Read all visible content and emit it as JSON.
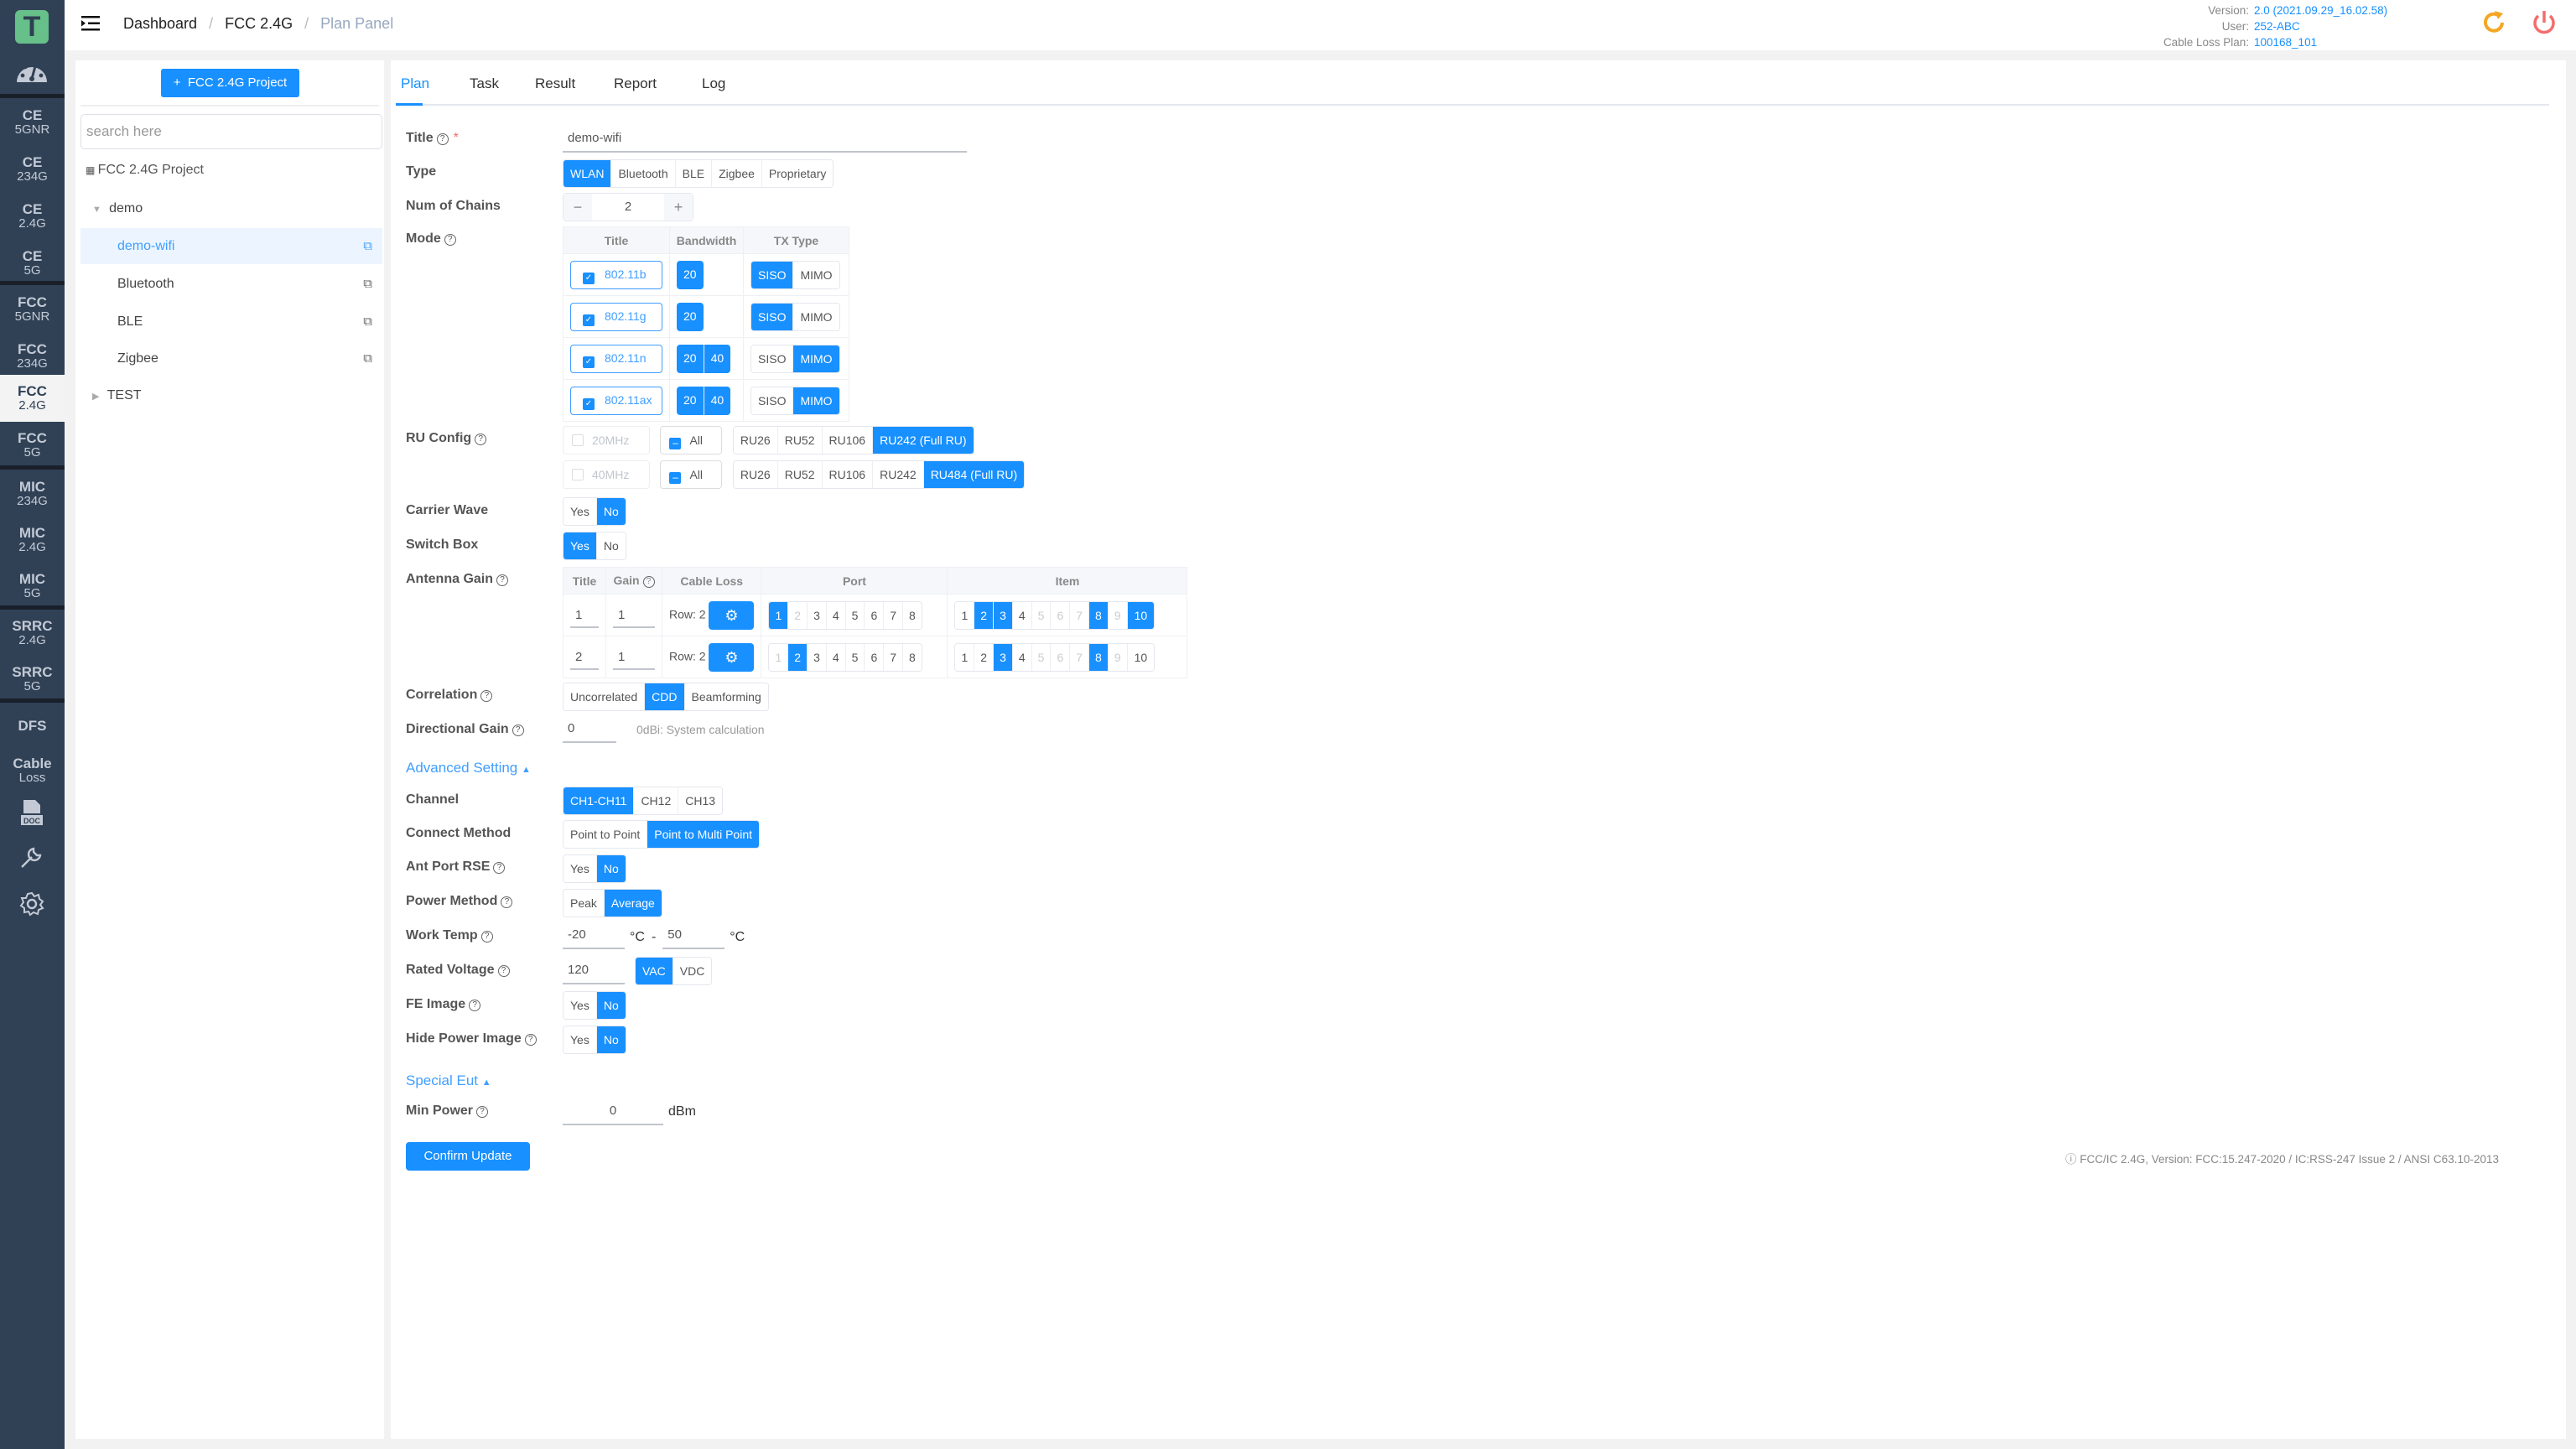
{
  "header": {
    "breadcrumb": [
      "Dashboard",
      "FCC 2.4G",
      "Plan Panel"
    ],
    "info": {
      "version_label": "Version:",
      "version": "2.0 (2021.09.29_16.02.58)",
      "user_label": "User:",
      "user": "252-ABC",
      "cable_label": "Cable Loss Plan:",
      "cable": "100168_101"
    },
    "colors": {
      "refresh": "#f5a623",
      "power": "#f56c6c",
      "accent": "#1890ff"
    }
  },
  "rail": {
    "logo": "T",
    "items": [
      {
        "top": "CE",
        "bottom": "5GNR"
      },
      {
        "top": "CE",
        "bottom": "234G"
      },
      {
        "top": "CE",
        "bottom": "2.4G"
      },
      {
        "top": "CE",
        "bottom": "5G"
      },
      {
        "top": "FCC",
        "bottom": "5GNR"
      },
      {
        "top": "FCC",
        "bottom": "234G"
      },
      {
        "top": "FCC",
        "bottom": "2.4G"
      },
      {
        "top": "FCC",
        "bottom": "5G"
      },
      {
        "top": "MIC",
        "bottom": "234G"
      },
      {
        "top": "MIC",
        "bottom": "2.4G"
      },
      {
        "top": "MIC",
        "bottom": "5G"
      },
      {
        "top": "SRRC",
        "bottom": "2.4G"
      },
      {
        "top": "SRRC",
        "bottom": "5G"
      },
      {
        "top": "DFS",
        "bottom": ""
      },
      {
        "top": "Cable",
        "bottom": "Loss"
      }
    ],
    "active": "FCC 2.4G"
  },
  "project": {
    "add_button": "FCC 2.4G Project",
    "search_placeholder": "search here",
    "root": "FCC 2.4G Project",
    "tree": [
      {
        "label": "demo",
        "expanded": true
      },
      {
        "label": "demo-wifi",
        "selected": true
      },
      {
        "label": "Bluetooth"
      },
      {
        "label": "BLE"
      },
      {
        "label": "Zigbee"
      },
      {
        "label": "TEST",
        "expanded": false
      }
    ]
  },
  "tabs": [
    "Plan",
    "Task",
    "Result",
    "Report",
    "Log"
  ],
  "form": {
    "title_label": "Title",
    "title_value": "demo-wifi",
    "type_label": "Type",
    "type_options": [
      "WLAN",
      "Bluetooth",
      "BLE",
      "Zigbee",
      "Proprietary"
    ],
    "type_selected": "WLAN",
    "chains_label": "Num of Chains",
    "chains_value": "2",
    "mode_label": "Mode",
    "mode_headers": [
      "Title",
      "Bandwidth",
      "TX Type"
    ],
    "modes": [
      {
        "title": "802.11b",
        "bw": [
          "20"
        ],
        "tx": "SISO"
      },
      {
        "title": "802.11g",
        "bw": [
          "20"
        ],
        "tx": "SISO"
      },
      {
        "title": "802.11n",
        "bw": [
          "20",
          "40"
        ],
        "tx": "MIMO"
      },
      {
        "title": "802.11ax",
        "bw": [
          "20",
          "40"
        ],
        "tx": "MIMO"
      }
    ],
    "tx_options": [
      "SISO",
      "MIMO"
    ],
    "ru_label": "RU Config",
    "ru": [
      {
        "bw": "20MHz",
        "all": "All",
        "options": [
          "RU26",
          "RU52",
          "RU106",
          "RU242 (Full RU)"
        ],
        "selected": "RU242 (Full RU)"
      },
      {
        "bw": "40MHz",
        "all": "All",
        "options": [
          "RU26",
          "RU52",
          "RU106",
          "RU242",
          "RU484 (Full RU)"
        ],
        "selected": "RU484 (Full RU)"
      }
    ],
    "carrier_label": "Carrier Wave",
    "carrier": "No",
    "switch_label": "Switch Box",
    "switch": "Yes",
    "yes": "Yes",
    "no": "No",
    "antenna_label": "Antenna Gain",
    "antenna_headers": [
      "Title",
      "Gain",
      "Cable Loss",
      "Port",
      "Item"
    ],
    "antennas": [
      {
        "title": "1",
        "gain": "1",
        "row": "Row: 2",
        "port_selected": [
          1
        ],
        "port_disabled": [
          2
        ],
        "item_selected": [
          2,
          3,
          8,
          10
        ],
        "item_disabled": [
          5,
          6,
          7,
          9
        ]
      },
      {
        "title": "2",
        "gain": "1",
        "row": "Row: 2",
        "port_selected": [
          2
        ],
        "port_disabled": [
          1
        ],
        "item_selected": [
          3,
          8
        ],
        "item_disabled": [
          5,
          6,
          7,
          9
        ]
      }
    ],
    "correlation_label": "Correlation",
    "correlation_options": [
      "Uncorrelated",
      "CDD",
      "Beamforming"
    ],
    "correlation": "CDD",
    "dgain_label": "Directional Gain",
    "dgain_value": "0",
    "dgain_hint": "0dBi: System calculation",
    "advanced_label": "Advanced Setting",
    "channel_label": "Channel",
    "channel_options": [
      "CH1-CH11",
      "CH12",
      "CH13"
    ],
    "channel": "CH1-CH11",
    "connect_label": "Connect Method",
    "connect_options": [
      "Point to Point",
      "Point to Multi Point"
    ],
    "connect": "Point to Multi Point",
    "rse_label": "Ant Port RSE",
    "rse": "No",
    "power_label": "Power Method",
    "power_options": [
      "Peak",
      "Average"
    ],
    "power": "Average",
    "temp_label": "Work Temp",
    "temp_min": "-20",
    "temp_max": "50",
    "temp_unit": "°C",
    "temp_dash": "-",
    "voltage_label": "Rated Voltage",
    "voltage_value": "120",
    "voltage_options": [
      "VAC",
      "VDC"
    ],
    "voltage": "VAC",
    "fe_label": "FE Image",
    "fe": "No",
    "hide_label": "Hide Power Image",
    "hide": "No",
    "special_label": "Special Eut",
    "minpower_label": "Min Power",
    "minpower_value": "0",
    "minpower_unit": "dBm",
    "confirm": "Confirm Update"
  },
  "footer": "FCC/IC 2.4G, Version: FCC:15.247-2020 / IC:RSS-247 Issue 2 / ANSI C63.10-2013"
}
